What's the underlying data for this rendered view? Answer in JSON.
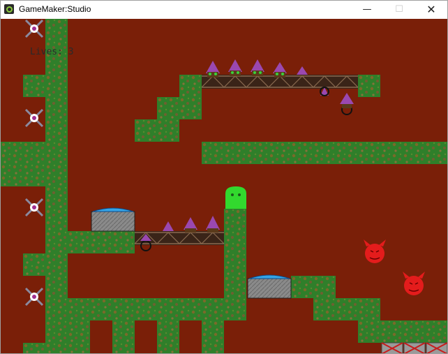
{
  "window": {
    "title": "GameMaker:Studio",
    "minimize_glyph": "—",
    "maximize_glyph": "☐",
    "close_glyph": "✕"
  },
  "hud": {
    "lives_text": "Lives: 3",
    "lives": 3
  },
  "colors": {
    "background": "#7a1f08",
    "grass": "#2f7f2a",
    "grass_spot": "#7a6a2a",
    "ghost": "#32d82e",
    "spike": "#9a48b0",
    "bridge": "#3a2418",
    "devil": "#e41c1c",
    "drone": "#8a8aa0",
    "water": "#35a4e6",
    "stone": "#8a8a8a"
  },
  "icons": {
    "app": "gamemaker-icon",
    "player": "ghost-icon",
    "enemy": "devil-icon",
    "drone": "eye-drone-icon",
    "hazard": "spike-icon",
    "goal": "crate-icon"
  }
}
